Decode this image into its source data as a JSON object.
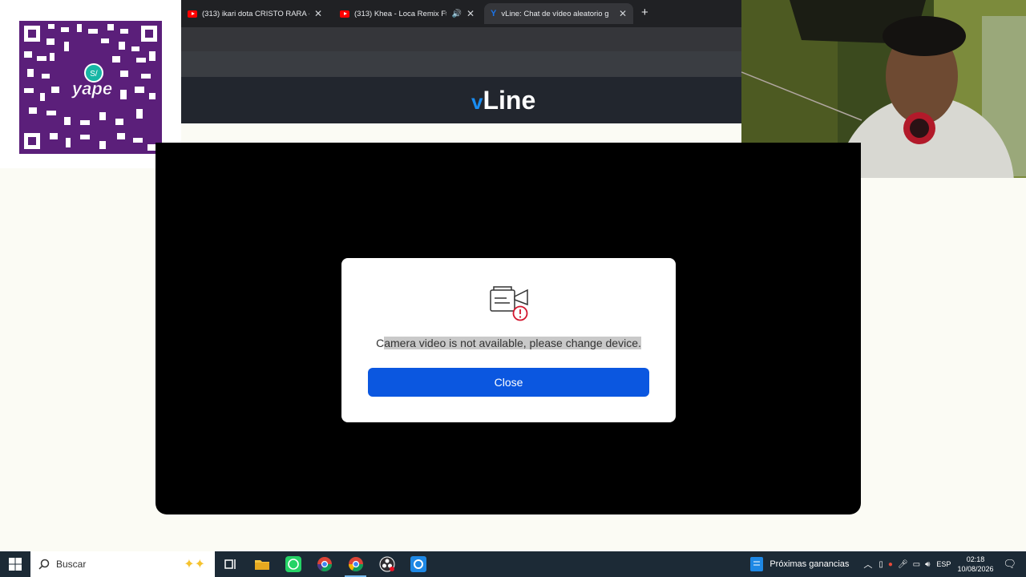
{
  "browser": {
    "tabs": [
      {
        "title": "(313) ikari dota CRISTO RARA -",
        "icon": "youtube-icon"
      },
      {
        "title": "(313) Khea - Loca Remix Ft.",
        "icon": "youtube-icon"
      },
      {
        "title": "vLine: Chat de vídeo aleatorio g",
        "icon": "vline-icon"
      }
    ]
  },
  "site": {
    "logo_text": "Line",
    "logo_mark": "v"
  },
  "modal": {
    "message_first": "C",
    "message_rest": "amera video is not available, please change device.",
    "close_label": "Close"
  },
  "overlay": {
    "qr_brand": "yape",
    "qr_badge": "S/"
  },
  "taskbar": {
    "search_placeholder": "Buscar",
    "news_label": "Próximas ganancias",
    "language": "ESP",
    "time": "02:18",
    "date": "10/08/2026"
  },
  "colors": {
    "accent": "#0b57e0",
    "taskbar": "#1c2a36",
    "qr": "#5b1f7a"
  }
}
